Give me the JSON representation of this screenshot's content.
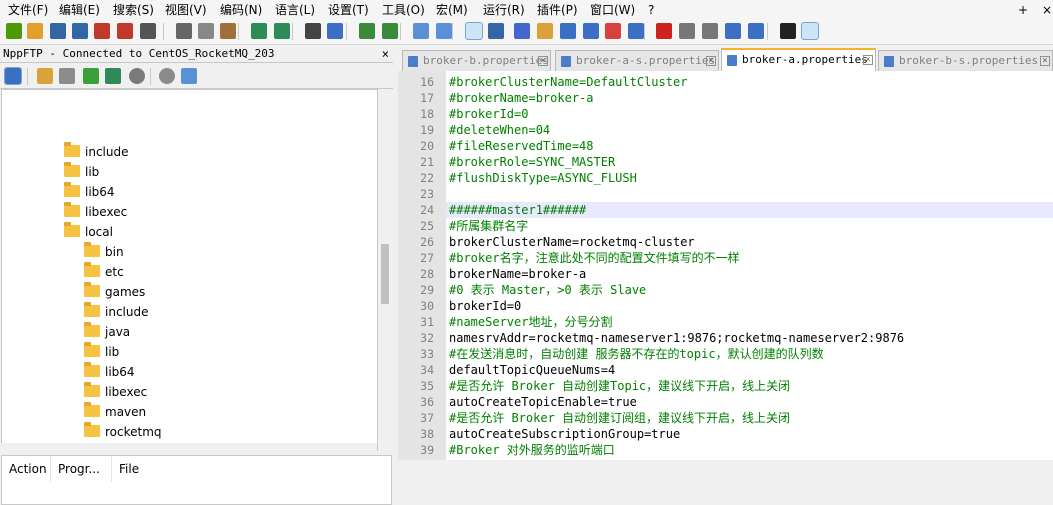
{
  "menu": {
    "items": [
      "文件(F)",
      "编辑(E)",
      "搜索(S)",
      "视图(V)",
      "编码(N)",
      "语言(L)",
      "设置(T)",
      "工具(O)",
      "宏(M)",
      "运行(R)",
      "插件(P)",
      "窗口(W)",
      "?"
    ],
    "right_arrow": "+",
    "close": "×"
  },
  "toolbar": {
    "icons": [
      "new-file-icon",
      "open-file-icon",
      "save-icon",
      "save-all-icon",
      "close-icon",
      "close-all-icon",
      "print-icon",
      "cut-icon",
      "copy-icon",
      "paste-icon",
      "undo-icon",
      "redo-icon",
      "find-icon",
      "replace-icon",
      "zoom-in-icon",
      "zoom-out-icon",
      "sync-v-icon",
      "sync-h-icon",
      "word-wrap-icon",
      "show-all-chars-icon",
      "indent-guide-icon",
      "udl-icon",
      "doc-map-icon",
      "function-list-icon",
      "folder-workspace-icon",
      "monitoring-icon",
      "record-macro-icon",
      "stop-macro-icon",
      "play-macro-icon",
      "run-macro-multiple-icon",
      "save-macro-icon",
      "markdown-icon",
      "ftp-icon"
    ]
  },
  "ftp": {
    "title": "NppFTP - Connected to CentOS_RocketMQ_203",
    "close": "×",
    "tree": [
      {
        "label": "include",
        "level": 0
      },
      {
        "label": "lib",
        "level": 0
      },
      {
        "label": "lib64",
        "level": 0
      },
      {
        "label": "libexec",
        "level": 0
      },
      {
        "label": "local",
        "level": 0
      },
      {
        "label": "bin",
        "level": 1
      },
      {
        "label": "etc",
        "level": 1
      },
      {
        "label": "games",
        "level": 1
      },
      {
        "label": "include",
        "level": 1
      },
      {
        "label": "java",
        "level": 1
      },
      {
        "label": "lib",
        "level": 1
      },
      {
        "label": "lib64",
        "level": 1
      },
      {
        "label": "libexec",
        "level": 1
      },
      {
        "label": "maven",
        "level": 1
      },
      {
        "label": "rocketmq",
        "level": 1
      }
    ],
    "queue_columns": [
      "Action",
      "Progr...",
      "File"
    ]
  },
  "editor": {
    "tabs": [
      {
        "label": "broker-b.properties",
        "active": false
      },
      {
        "label": "broker-a-s.properties",
        "active": false
      },
      {
        "label": "broker-a.properties",
        "active": true
      },
      {
        "label": "broker-b-s.properties",
        "active": false
      }
    ],
    "lines": [
      {
        "n": "16",
        "text": "#brokerClusterName=DefaultCluster",
        "comment": true
      },
      {
        "n": "17",
        "text": "#brokerName=broker-a",
        "comment": true
      },
      {
        "n": "18",
        "text": "#brokerId=0",
        "comment": true
      },
      {
        "n": "19",
        "text": "#deleteWhen=04",
        "comment": true
      },
      {
        "n": "20",
        "text": "#fileReservedTime=48",
        "comment": true
      },
      {
        "n": "21",
        "text": "#brokerRole=SYNC_MASTER",
        "comment": true
      },
      {
        "n": "22",
        "text": "#flushDiskType=ASYNC_FLUSH",
        "comment": true
      },
      {
        "n": "23",
        "text": "",
        "comment": false
      },
      {
        "n": "24",
        "text": "######master1######",
        "comment": true,
        "current": true
      },
      {
        "n": "25",
        "text": "#所属集群名字",
        "comment": true
      },
      {
        "n": "26",
        "text": "brokerClusterName=rocketmq-cluster",
        "comment": false
      },
      {
        "n": "27",
        "text": "#broker名字，注意此处不同的配置文件填写的不一样",
        "comment": true
      },
      {
        "n": "28",
        "text": "brokerName=broker-a",
        "comment": false
      },
      {
        "n": "29",
        "text": "#0 表示 Master，>0 表示 Slave",
        "comment": true
      },
      {
        "n": "30",
        "text": "brokerId=0",
        "comment": false
      },
      {
        "n": "31",
        "text": "#nameServer地址，分号分割",
        "comment": true
      },
      {
        "n": "32",
        "text": "namesrvAddr=rocketmq-nameserver1:9876;rocketmq-nameserver2:9876",
        "comment": false
      },
      {
        "n": "33",
        "text": "#在发送消息时，自动创建 服务器不存在的topic，默认创建的队列数",
        "comment": true
      },
      {
        "n": "34",
        "text": "defaultTopicQueueNums=4",
        "comment": false
      },
      {
        "n": "35",
        "text": "#是否允许 Broker 自动创建Topic，建议线下开启，线上关闭",
        "comment": true
      },
      {
        "n": "36",
        "text": "autoCreateTopicEnable=true",
        "comment": false
      },
      {
        "n": "37",
        "text": "#是否允许 Broker 自动创建订阅组，建议线下开启，线上关闭",
        "comment": true
      },
      {
        "n": "38",
        "text": "autoCreateSubscriptionGroup=true",
        "comment": false
      },
      {
        "n": "39",
        "text": "#Broker 对外服务的监听端口",
        "comment": true
      }
    ]
  },
  "colors": {
    "comment": "#008000",
    "active_tab_accent": "#f7b22b",
    "current_line": "#e8e8ff",
    "folder": "#f5c242"
  }
}
